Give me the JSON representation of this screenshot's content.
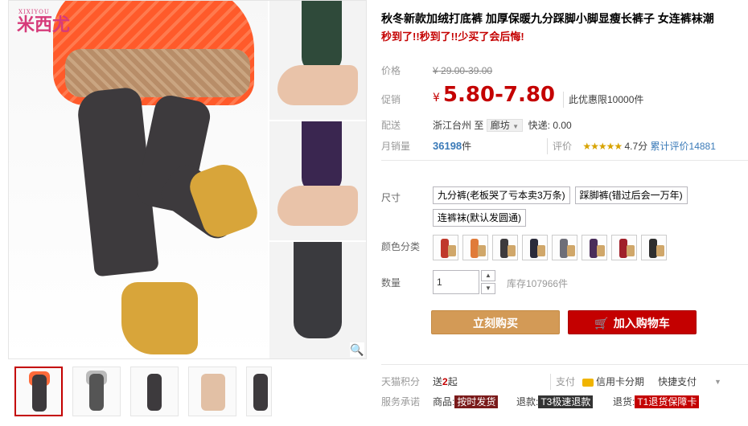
{
  "gallery": {
    "brand_latin": "XIXIYOU",
    "brand_cn": "米西尤"
  },
  "product": {
    "title": "秋冬新款加绒打底裤 加厚保暖九分踩脚小脚显瘦长裤子 女连裤袜潮",
    "subtitle": "秒到了!!秒到了!!少买了会后悔!"
  },
  "price": {
    "label": "价格",
    "currency": "¥",
    "original": "29.00-39.00",
    "promo_label": "促销",
    "promo": "5.80-7.80",
    "limit": "此优惠限10000件"
  },
  "shipping": {
    "label": "配送",
    "from": "浙江台州",
    "to_word": "至",
    "destination": "廊坊",
    "fee": "快递: 0.00"
  },
  "sales": {
    "label": "月销量",
    "count": "36198",
    "unit": "件",
    "review_label": "评价",
    "stars": "★★★★★",
    "score": "4.7分",
    "total_reviews": "累计评价14881"
  },
  "options": {
    "size_label": "尺寸",
    "sizes": [
      "九分裤(老板哭了亏本卖3万条)",
      "踩脚裤(错过后会一万年)",
      "连裤袜(默认发圆通)"
    ],
    "color_label": "颜色分类",
    "swatch_colors": [
      "#c0392b",
      "#e07b39",
      "#3d3a3d",
      "#2b2b3a",
      "#6e6e78",
      "#4a2d5a",
      "#a0202a",
      "#2f2f2f"
    ]
  },
  "purchase": {
    "qty_label": "数量",
    "qty": "1",
    "stock": "库存107966件",
    "buy_now": "立刻购买",
    "add_to_cart": "加入购物车"
  },
  "footer": {
    "points_label": "天猫积分",
    "points_prefix": "送",
    "points_value": "2",
    "points_suffix": "起",
    "pay_label": "支付",
    "credit": "信用卡分期",
    "quick_pay": "快捷支付",
    "service_label": "服务承诺",
    "goods_label": "商品:",
    "goods_tag": "按时发货",
    "refund_label": "退款:",
    "refund_tag": "T3极速退款",
    "return_label": "退货:",
    "return_tag": "T1退货保障卡"
  },
  "colors": {
    "accent_red": "#c40000",
    "buy_button": "#d39a56",
    "link_blue": "#3a7ab8"
  }
}
